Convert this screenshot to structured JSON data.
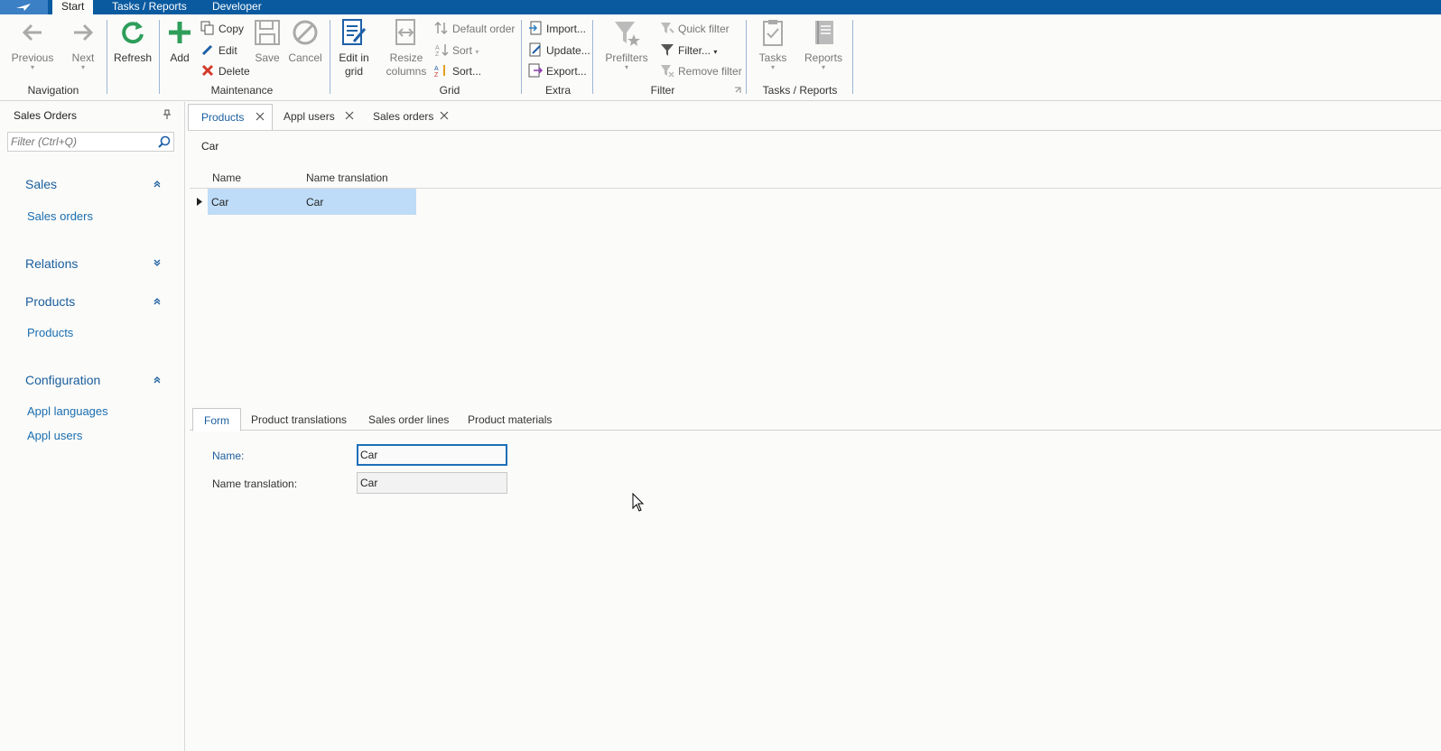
{
  "ribbon_tabs": [
    "Start",
    "Tasks / Reports",
    "Developer"
  ],
  "ribbon": {
    "navigation": {
      "label": "Navigation",
      "previous": "Previous",
      "next": "Next"
    },
    "refresh": "Refresh",
    "maintenance": {
      "label": "Maintenance",
      "add": "Add",
      "copy": "Copy",
      "edit": "Edit",
      "delete": "Delete",
      "save": "Save",
      "cancel": "Cancel"
    },
    "grid": {
      "label": "Grid",
      "edit_in_grid_1": "Edit in",
      "edit_in_grid_2": "grid",
      "resize_1": "Resize",
      "resize_2": "columns",
      "default_order": "Default order",
      "sort": "Sort",
      "sort_dialog": "Sort..."
    },
    "extra": {
      "label": "Extra",
      "import": "Import...",
      "update": "Update...",
      "export": "Export..."
    },
    "filter": {
      "label": "Filter",
      "prefilters": "Prefilters",
      "quick_filter": "Quick filter",
      "filter": "Filter...",
      "remove_filter": "Remove filter"
    },
    "tasks_reports": {
      "label": "Tasks / Reports",
      "tasks": "Tasks",
      "reports": "Reports"
    }
  },
  "sidebar": {
    "title": "Sales Orders",
    "filter_placeholder": "Filter (Ctrl+Q)",
    "sections": [
      {
        "header": "Sales",
        "items": [
          "Sales orders"
        ]
      },
      {
        "header": "Relations",
        "items": []
      },
      {
        "header": "Products",
        "items": [
          "Products"
        ]
      },
      {
        "header": "Configuration",
        "items": [
          "Appl languages",
          "Appl users"
        ]
      }
    ]
  },
  "doc_tabs": [
    "Products",
    "Appl users",
    "Sales orders"
  ],
  "grid": {
    "caption": "Car",
    "columns": [
      "Name",
      "Name translation"
    ],
    "rows": [
      [
        "Car",
        "Car"
      ]
    ]
  },
  "detail_tabs": [
    "Form",
    "Product translations",
    "Sales order lines",
    "Product materials"
  ],
  "form": {
    "name_label": "Name:",
    "name_value": "Car",
    "translation_label": "Name translation:",
    "translation_value": "Car"
  },
  "colors": {
    "accent": "#0a5aa0",
    "link": "#1a6eb0",
    "selection": "#bedcf7"
  }
}
